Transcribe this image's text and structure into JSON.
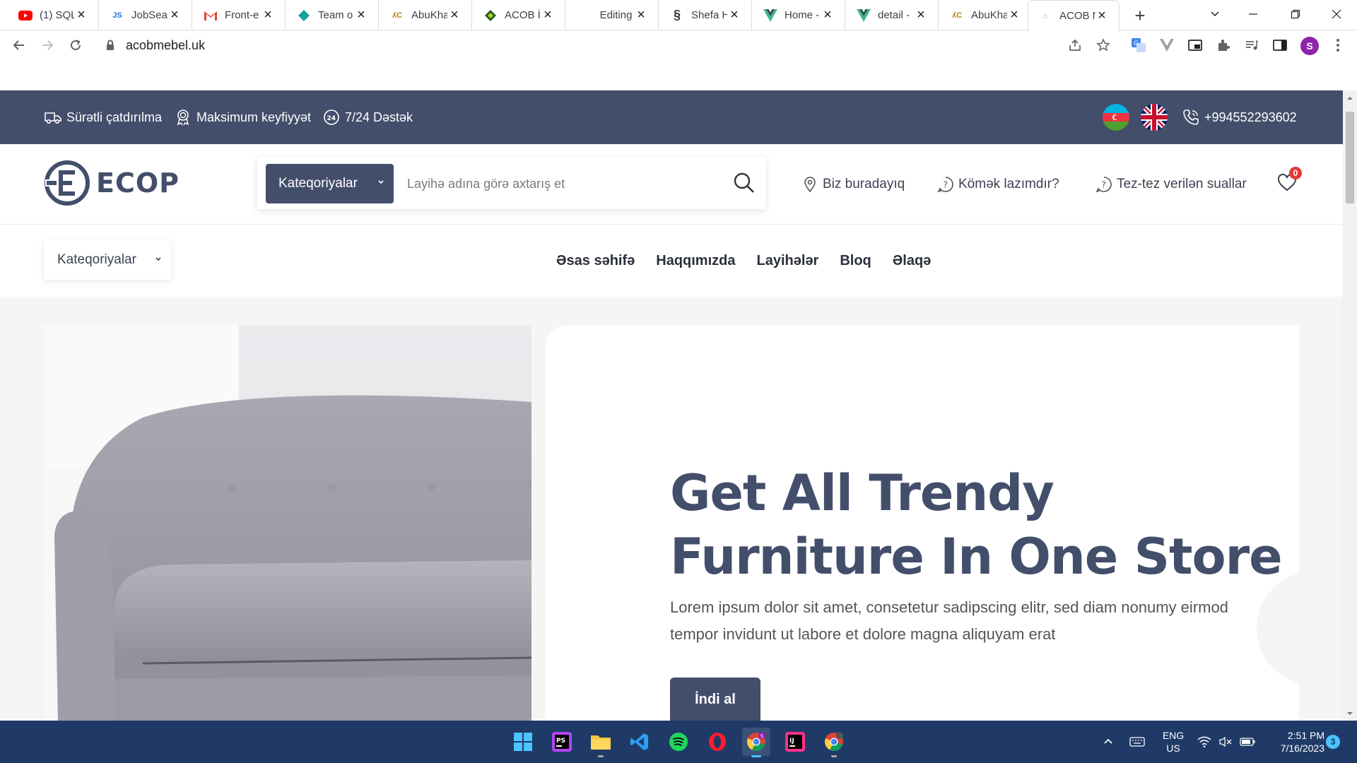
{
  "browser": {
    "tabs": [
      {
        "title": "(1) SQL",
        "favicon": "youtube-icon"
      },
      {
        "title": "JobSear",
        "favicon": "js-icon"
      },
      {
        "title": "Front-e",
        "favicon": "gmail-icon"
      },
      {
        "title": "Team o",
        "favicon": "diamond-icon"
      },
      {
        "title": "AbuKha",
        "favicon": "tree-logo-icon"
      },
      {
        "title": "ACOB İr",
        "favicon": "green-diamond-icon"
      },
      {
        "title": "Editing",
        "favicon": "blank-icon"
      },
      {
        "title": "Shefa H",
        "favicon": "s-logo-icon"
      },
      {
        "title": "Home -",
        "favicon": "vue-icon"
      },
      {
        "title": "detail -",
        "favicon": "vue-icon"
      },
      {
        "title": "AbuKha",
        "favicon": "tree-logo-icon"
      },
      {
        "title": "ACOB M",
        "favicon": "acob-logo-icon"
      }
    ],
    "url": "acobmebel.uk",
    "profile_initial": "S"
  },
  "site": {
    "features": [
      {
        "label": "Sürətli çatdırılma",
        "icon": "truck-icon"
      },
      {
        "label": "Maksimum keyfiyyət",
        "icon": "medal-icon"
      },
      {
        "label": "7/24 Dəstək",
        "icon": "support-24-icon"
      }
    ],
    "phone": "+994552293602",
    "logo_text": "ECOP",
    "search": {
      "category_button": "Kateqoriyalar",
      "placeholder": "Layihə adına görə axtarış et"
    },
    "header_links": [
      {
        "label": "Biz buradayıq",
        "icon": "location-pin-icon"
      },
      {
        "label": "Kömək lazımdır?",
        "icon": "help-icon"
      },
      {
        "label": "Tez-tez verilən suallar",
        "icon": "faq-icon"
      }
    ],
    "wishlist_count": "0",
    "category_dropdown": "Kateqoriyalar",
    "menu": [
      "Əsas səhifə",
      "Haqqımızda",
      "Layihələr",
      "Bloq",
      "Əlaqə"
    ],
    "hero": {
      "title_line1": "Get All Trendy",
      "title_line2": "Furniture In One Store",
      "description": "Lorem ipsum dolor sit amet, consetetur sadipscing elitr, sed diam nonumy eirmod tempor invidunt ut labore et dolore magna aliquyam erat",
      "button": "İndi al"
    }
  },
  "taskbar": {
    "apps": [
      "windows-start-icon",
      "phpstorm-icon",
      "file-explorer-icon",
      "vscode-icon",
      "spotify-icon",
      "opera-icon",
      "chrome-icon",
      "intellij-icon",
      "chrome-icon"
    ],
    "language_line1": "ENG",
    "language_line2": "US",
    "time": "2:51 PM",
    "date": "7/16/2023",
    "notifications": "3"
  },
  "colors": {
    "brand": "#434e6b",
    "badge": "#e53935",
    "taskbar": "#1f3a67"
  }
}
